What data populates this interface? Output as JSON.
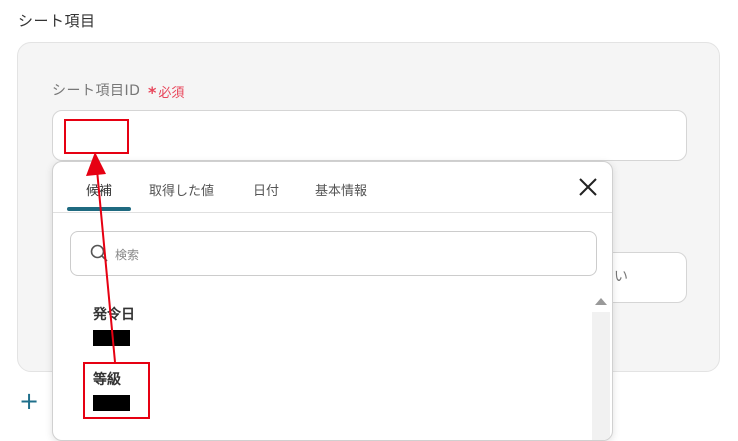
{
  "section": {
    "title": "シート項目"
  },
  "field": {
    "label": "シート項目ID",
    "required_label": "必須",
    "required_mark": "*",
    "value": ""
  },
  "partial_input": {
    "text_fragment": "い"
  },
  "add_button": {
    "label": "+"
  },
  "dropdown": {
    "tabs": [
      {
        "label": "候補",
        "active": true
      },
      {
        "label": "取得した値",
        "active": false
      },
      {
        "label": "日付",
        "active": false
      },
      {
        "label": "基本情報",
        "active": false
      }
    ],
    "search_placeholder": "検索",
    "items": [
      {
        "label": "発令日",
        "value_redacted": true
      },
      {
        "label": "等級",
        "value_redacted": true
      }
    ]
  },
  "colors": {
    "accent": "#1f6a80",
    "required": "#e8455a",
    "annotation": "#e60012"
  }
}
